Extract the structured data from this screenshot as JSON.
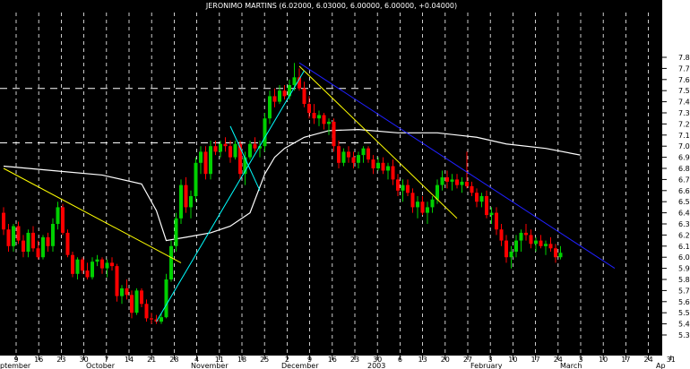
{
  "chart_data": {
    "type": "candlestick",
    "title": "JERONIMO MARTINS (6.02000, 6.03000, 6.00000, 6.00000, +0.04000)",
    "y_ticks": [
      "5.3",
      "5.4",
      "5.5",
      "5.6",
      "5.7",
      "5.8",
      "5.9",
      "6.0",
      "6.1",
      "6.2",
      "6.3",
      "6.4",
      "6.5",
      "6.6",
      "6.7",
      "6.8",
      "6.9",
      "7.0",
      "7.1",
      "7.2",
      "7.3",
      "7.4",
      "7.5",
      "7.6",
      "7.7",
      "7.8"
    ],
    "ylim": [
      5.24,
      7.84
    ],
    "x_day_labels": [
      "9",
      "16",
      "23",
      "30",
      "7",
      "14",
      "21",
      "28",
      "4",
      "11",
      "18",
      "25",
      "2",
      "9",
      "16",
      "23",
      "30",
      "6",
      "13",
      "20",
      "27",
      "3",
      "10",
      "17",
      "24",
      "3",
      "10",
      "17",
      "24",
      "31"
    ],
    "x_month_labels": [
      "ptember",
      "October",
      "November",
      "December",
      "2003",
      "February",
      "March",
      "Ap"
    ],
    "grid": true,
    "colors": {
      "up": "#00d000",
      "down": "#ff0000",
      "moving_average": "#ffffff",
      "trend_yellow": "#ffff00",
      "trend_cyan": "#00ffff",
      "trend_blue": "#2020ff",
      "background": "#000000",
      "axis_bg": "#ffffff"
    },
    "candles": [
      {
        "o": 6.4,
        "h": 6.45,
        "l": 6.2,
        "c": 6.25
      },
      {
        "o": 6.25,
        "h": 6.3,
        "l": 6.05,
        "c": 6.1
      },
      {
        "o": 6.1,
        "h": 6.3,
        "l": 6.05,
        "c": 6.28
      },
      {
        "o": 6.28,
        "h": 6.32,
        "l": 6.12,
        "c": 6.15
      },
      {
        "o": 6.15,
        "h": 6.2,
        "l": 6.0,
        "c": 6.05
      },
      {
        "o": 6.05,
        "h": 6.25,
        "l": 6.0,
        "c": 6.22
      },
      {
        "o": 6.22,
        "h": 6.28,
        "l": 6.05,
        "c": 6.08
      },
      {
        "o": 6.08,
        "h": 6.15,
        "l": 5.98,
        "c": 6.0
      },
      {
        "o": 6.0,
        "h": 6.2,
        "l": 5.98,
        "c": 6.18
      },
      {
        "o": 6.18,
        "h": 6.22,
        "l": 6.05,
        "c": 6.1
      },
      {
        "o": 6.1,
        "h": 6.35,
        "l": 6.05,
        "c": 6.3
      },
      {
        "o": 6.3,
        "h": 6.5,
        "l": 6.25,
        "c": 6.45
      },
      {
        "o": 6.45,
        "h": 6.48,
        "l": 6.2,
        "c": 6.22
      },
      {
        "o": 6.22,
        "h": 6.25,
        "l": 6.0,
        "c": 6.02
      },
      {
        "o": 6.02,
        "h": 6.05,
        "l": 5.82,
        "c": 5.85
      },
      {
        "o": 5.85,
        "h": 6.0,
        "l": 5.8,
        "c": 5.98
      },
      {
        "o": 5.98,
        "h": 6.0,
        "l": 5.85,
        "c": 5.88
      },
      {
        "o": 5.88,
        "h": 5.95,
        "l": 5.8,
        "c": 5.82
      },
      {
        "o": 5.82,
        "h": 6.0,
        "l": 5.8,
        "c": 5.96
      },
      {
        "o": 5.96,
        "h": 6.02,
        "l": 5.92,
        "c": 5.98
      },
      {
        "o": 5.98,
        "h": 6.0,
        "l": 5.85,
        "c": 5.9
      },
      {
        "o": 5.9,
        "h": 5.98,
        "l": 5.82,
        "c": 5.95
      },
      {
        "o": 5.95,
        "h": 6.0,
        "l": 5.88,
        "c": 5.92
      },
      {
        "o": 5.92,
        "h": 5.94,
        "l": 5.6,
        "c": 5.65
      },
      {
        "o": 5.65,
        "h": 5.75,
        "l": 5.58,
        "c": 5.72
      },
      {
        "o": 5.72,
        "h": 5.8,
        "l": 5.62,
        "c": 5.66
      },
      {
        "o": 5.66,
        "h": 5.7,
        "l": 5.45,
        "c": 5.5
      },
      {
        "o": 5.5,
        "h": 5.72,
        "l": 5.48,
        "c": 5.7
      },
      {
        "o": 5.7,
        "h": 5.72,
        "l": 5.55,
        "c": 5.58
      },
      {
        "o": 5.58,
        "h": 5.62,
        "l": 5.42,
        "c": 5.45
      },
      {
        "o": 5.45,
        "h": 5.5,
        "l": 5.4,
        "c": 5.44
      },
      {
        "o": 5.44,
        "h": 5.48,
        "l": 5.4,
        "c": 5.42
      },
      {
        "o": 5.42,
        "h": 5.5,
        "l": 5.4,
        "c": 5.46
      },
      {
        "o": 5.46,
        "h": 5.85,
        "l": 5.45,
        "c": 5.8
      },
      {
        "o": 5.8,
        "h": 6.15,
        "l": 5.78,
        "c": 6.1
      },
      {
        "o": 6.1,
        "h": 6.4,
        "l": 6.05,
        "c": 6.35
      },
      {
        "o": 6.35,
        "h": 6.7,
        "l": 6.3,
        "c": 6.65
      },
      {
        "o": 6.65,
        "h": 6.72,
        "l": 6.4,
        "c": 6.45
      },
      {
        "o": 6.45,
        "h": 6.6,
        "l": 6.35,
        "c": 6.55
      },
      {
        "o": 6.55,
        "h": 6.9,
        "l": 6.5,
        "c": 6.85
      },
      {
        "o": 6.85,
        "h": 7.0,
        "l": 6.75,
        "c": 6.95
      },
      {
        "o": 6.95,
        "h": 7.0,
        "l": 6.7,
        "c": 6.75
      },
      {
        "o": 6.75,
        "h": 7.05,
        "l": 6.7,
        "c": 7.0
      },
      {
        "o": 7.0,
        "h": 7.05,
        "l": 6.92,
        "c": 6.95
      },
      {
        "o": 6.95,
        "h": 7.05,
        "l": 6.9,
        "c": 7.02
      },
      {
        "o": 7.02,
        "h": 7.08,
        "l": 6.95,
        "c": 7.0
      },
      {
        "o": 7.0,
        "h": 7.05,
        "l": 6.85,
        "c": 6.9
      },
      {
        "o": 6.9,
        "h": 7.05,
        "l": 6.88,
        "c": 7.02
      },
      {
        "o": 7.02,
        "h": 7.05,
        "l": 6.7,
        "c": 6.75
      },
      {
        "o": 6.75,
        "h": 6.95,
        "l": 6.65,
        "c": 6.9
      },
      {
        "o": 6.9,
        "h": 7.05,
        "l": 6.88,
        "c": 7.02
      },
      {
        "o": 7.02,
        "h": 7.08,
        "l": 6.95,
        "c": 6.98
      },
      {
        "o": 6.98,
        "h": 7.05,
        "l": 6.9,
        "c": 7.0
      },
      {
        "o": 7.0,
        "h": 7.3,
        "l": 6.95,
        "c": 7.25
      },
      {
        "o": 7.25,
        "h": 7.5,
        "l": 7.2,
        "c": 7.45
      },
      {
        "o": 7.45,
        "h": 7.52,
        "l": 7.35,
        "c": 7.4
      },
      {
        "o": 7.4,
        "h": 7.55,
        "l": 7.38,
        "c": 7.5
      },
      {
        "o": 7.5,
        "h": 7.55,
        "l": 7.42,
        "c": 7.45
      },
      {
        "o": 7.45,
        "h": 7.6,
        "l": 7.42,
        "c": 7.55
      },
      {
        "o": 7.55,
        "h": 7.75,
        "l": 7.5,
        "c": 7.62
      },
      {
        "o": 7.62,
        "h": 7.7,
        "l": 7.5,
        "c": 7.52
      },
      {
        "o": 7.52,
        "h": 7.58,
        "l": 7.35,
        "c": 7.38
      },
      {
        "o": 7.38,
        "h": 7.45,
        "l": 7.25,
        "c": 7.3
      },
      {
        "o": 7.3,
        "h": 7.38,
        "l": 7.2,
        "c": 7.25
      },
      {
        "o": 7.25,
        "h": 7.32,
        "l": 7.18,
        "c": 7.28
      },
      {
        "o": 7.28,
        "h": 7.3,
        "l": 7.15,
        "c": 7.2
      },
      {
        "o": 7.2,
        "h": 7.25,
        "l": 7.1,
        "c": 7.22
      },
      {
        "o": 7.22,
        "h": 7.25,
        "l": 6.95,
        "c": 7.0
      },
      {
        "o": 7.0,
        "h": 7.05,
        "l": 6.8,
        "c": 6.85
      },
      {
        "o": 6.85,
        "h": 6.98,
        "l": 6.82,
        "c": 6.95
      },
      {
        "o": 6.95,
        "h": 7.0,
        "l": 6.85,
        "c": 6.9
      },
      {
        "o": 6.9,
        "h": 6.95,
        "l": 6.8,
        "c": 6.85
      },
      {
        "o": 6.85,
        "h": 6.95,
        "l": 6.8,
        "c": 6.92
      },
      {
        "o": 6.92,
        "h": 7.0,
        "l": 6.85,
        "c": 6.98
      },
      {
        "o": 6.98,
        "h": 7.0,
        "l": 6.85,
        "c": 6.88
      },
      {
        "o": 6.88,
        "h": 6.92,
        "l": 6.75,
        "c": 6.8
      },
      {
        "o": 6.8,
        "h": 6.9,
        "l": 6.78,
        "c": 6.85
      },
      {
        "o": 6.85,
        "h": 6.9,
        "l": 6.75,
        "c": 6.78
      },
      {
        "o": 6.78,
        "h": 6.85,
        "l": 6.7,
        "c": 6.82
      },
      {
        "o": 6.82,
        "h": 6.88,
        "l": 6.65,
        "c": 6.7
      },
      {
        "o": 6.7,
        "h": 6.75,
        "l": 6.55,
        "c": 6.6
      },
      {
        "o": 6.6,
        "h": 6.7,
        "l": 6.5,
        "c": 6.65
      },
      {
        "o": 6.65,
        "h": 6.7,
        "l": 6.55,
        "c": 6.58
      },
      {
        "o": 6.58,
        "h": 6.62,
        "l": 6.4,
        "c": 6.45
      },
      {
        "o": 6.45,
        "h": 6.55,
        "l": 6.35,
        "c": 6.5
      },
      {
        "o": 6.5,
        "h": 6.55,
        "l": 6.38,
        "c": 6.4
      },
      {
        "o": 6.4,
        "h": 6.5,
        "l": 6.3,
        "c": 6.45
      },
      {
        "o": 6.45,
        "h": 6.55,
        "l": 6.4,
        "c": 6.52
      },
      {
        "o": 6.52,
        "h": 6.7,
        "l": 6.48,
        "c": 6.65
      },
      {
        "o": 6.65,
        "h": 6.78,
        "l": 6.6,
        "c": 6.72
      },
      {
        "o": 6.72,
        "h": 6.78,
        "l": 6.62,
        "c": 6.68
      },
      {
        "o": 6.68,
        "h": 6.75,
        "l": 6.6,
        "c": 6.7
      },
      {
        "o": 6.7,
        "h": 6.75,
        "l": 6.62,
        "c": 6.65
      },
      {
        "o": 6.65,
        "h": 6.72,
        "l": 6.58,
        "c": 6.68
      },
      {
        "o": 6.68,
        "h": 6.95,
        "l": 6.62,
        "c": 6.64
      },
      {
        "o": 6.64,
        "h": 6.68,
        "l": 6.55,
        "c": 6.58
      },
      {
        "o": 6.58,
        "h": 6.62,
        "l": 6.45,
        "c": 6.5
      },
      {
        "o": 6.5,
        "h": 6.58,
        "l": 6.45,
        "c": 6.55
      },
      {
        "o": 6.55,
        "h": 6.6,
        "l": 6.35,
        "c": 6.38
      },
      {
        "o": 6.38,
        "h": 6.45,
        "l": 6.3,
        "c": 6.4
      },
      {
        "o": 6.4,
        "h": 6.45,
        "l": 6.2,
        "c": 6.25
      },
      {
        "o": 6.25,
        "h": 6.3,
        "l": 6.1,
        "c": 6.15
      },
      {
        "o": 6.15,
        "h": 6.2,
        "l": 5.95,
        "c": 6.0
      },
      {
        "o": 6.0,
        "h": 6.1,
        "l": 5.9,
        "c": 6.05
      },
      {
        "o": 6.05,
        "h": 6.2,
        "l": 6.0,
        "c": 6.15
      },
      {
        "o": 6.15,
        "h": 6.25,
        "l": 6.05,
        "c": 6.22
      },
      {
        "o": 6.22,
        "h": 6.3,
        "l": 6.15,
        "c": 6.2
      },
      {
        "o": 6.2,
        "h": 6.25,
        "l": 6.08,
        "c": 6.12
      },
      {
        "o": 6.12,
        "h": 6.18,
        "l": 6.05,
        "c": 6.15
      },
      {
        "o": 6.15,
        "h": 6.2,
        "l": 6.08,
        "c": 6.1
      },
      {
        "o": 6.1,
        "h": 6.15,
        "l": 6.02,
        "c": 6.12
      },
      {
        "o": 6.12,
        "h": 6.18,
        "l": 6.05,
        "c": 6.08
      },
      {
        "o": 6.08,
        "h": 6.12,
        "l": 5.95,
        "c": 6.0
      },
      {
        "o": 6.0,
        "h": 6.1,
        "l": 5.98,
        "c": 6.04
      }
    ],
    "moving_average": [
      [
        0,
        6.82
      ],
      [
        10,
        6.78
      ],
      [
        20,
        6.74
      ],
      [
        28,
        6.66
      ],
      [
        31,
        6.42
      ],
      [
        33,
        6.15
      ],
      [
        37,
        6.18
      ],
      [
        42,
        6.22
      ],
      [
        46,
        6.28
      ],
      [
        50,
        6.4
      ],
      [
        53,
        6.75
      ],
      [
        55,
        6.9
      ],
      [
        57,
        6.98
      ],
      [
        61,
        7.08
      ],
      [
        66,
        7.14
      ],
      [
        72,
        7.15
      ],
      [
        80,
        7.12
      ],
      [
        88,
        7.12
      ],
      [
        96,
        7.08
      ],
      [
        102,
        7.02
      ],
      [
        110,
        6.98
      ],
      [
        117,
        6.92
      ]
    ],
    "trend_lines": [
      {
        "color": "yellow",
        "from": [
          0,
          6.8
        ],
        "to": [
          36,
          5.95
        ]
      },
      {
        "color": "yellow",
        "from": [
          60,
          7.72
        ],
        "to": [
          92,
          6.35
        ]
      },
      {
        "color": "cyan",
        "from": [
          31,
          5.42
        ],
        "to": [
          61,
          7.68
        ]
      },
      {
        "color": "cyan",
        "from": [
          46,
          7.18
        ],
        "to": [
          52,
          6.6
        ]
      },
      {
        "color": "blue",
        "from": [
          60,
          7.75
        ],
        "to": [
          124,
          5.9
        ]
      }
    ],
    "horizontal_levels": [
      7.52,
      7.03
    ]
  }
}
